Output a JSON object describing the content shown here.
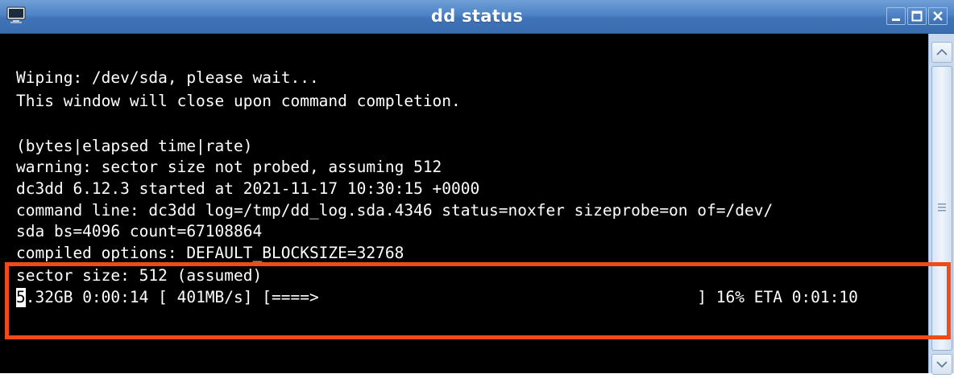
{
  "window": {
    "title": "dd status",
    "icons": {
      "app": "terminal-app-icon",
      "minimize": "minimize-icon",
      "maximize": "maximize-icon",
      "close": "close-icon"
    }
  },
  "terminal": {
    "lines": [
      "Wiping: /dev/sda, please wait...",
      "This window will close upon command completion.",
      "",
      "(bytes|elapsed time|rate)",
      "warning: sector size not probed, assuming 512",
      "dc3dd 6.12.3 started at 2021-11-17 10:30:15 +0000",
      "command line: dc3dd log=/tmp/dd_log.sda.4346 status=noxfer sizeprobe=on of=/dev/",
      "sda bs=4096 count=67108864",
      "compiled options: DEFAULT_BLOCKSIZE=32768",
      "sector size: 512 (assumed)"
    ],
    "progress": {
      "cursor_char": "5",
      "text": ".32GB 0:00:14 [ 401MB/s] [====>                                        ] 16% ETA 0:01:10",
      "percent": 16
    }
  },
  "colors": {
    "titlebar": "#4d83c6",
    "terminal_bg": "#000000",
    "terminal_fg": "#ffffff",
    "highlight": "#f04a18"
  }
}
